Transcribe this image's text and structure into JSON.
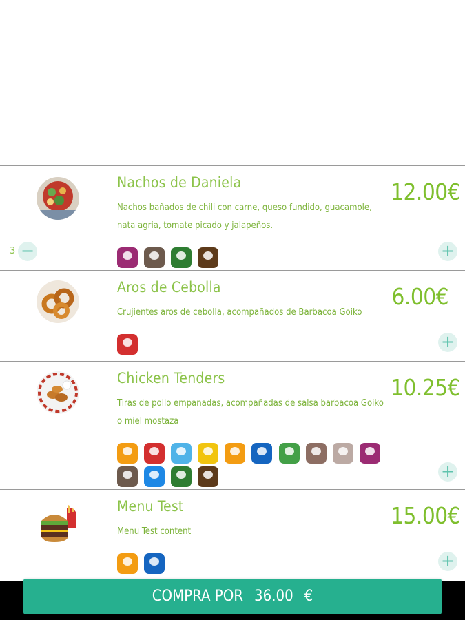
{
  "items": [
    {
      "title": "Nachos de Daniela",
      "description": "Nachos bañados de chili con carne, queso fundido, guacamole, nata agria, tomate picado y jalapeños.",
      "price": "12.00€",
      "quantity": "3",
      "allergen_icons": [
        "mollusk-icon",
        "milk-icon",
        "soy-icon",
        "peanut-icon"
      ],
      "allergen_colors": [
        "#9b2b73",
        "#6d5a4d",
        "#2e7d32",
        "#5d3a1a"
      ]
    },
    {
      "title": "Aros de Cebolla",
      "description": "Crujientes aros de cebolla, acompañados de Barbacoa Goiko",
      "price": "6.00€",
      "allergen_icons": [
        "crustacean-icon"
      ],
      "allergen_colors": [
        "#d32f2f"
      ]
    },
    {
      "title": "Chicken Tenders",
      "description": "Tiras de pollo empanadas, acompañadas de salsa barbacoa Goiko o miel mostaza",
      "price": "10.25€",
      "allergen_icons": [
        "gluten-icon",
        "crustacean-icon",
        "fish-icon",
        "egg-icon",
        "peanut-icon",
        "mustard-icon",
        "celery-icon",
        "nuts-icon",
        "sesame-icon",
        "mollusk-icon",
        "milk-icon",
        "sulphite-icon",
        "soy-icon",
        "lupin-icon"
      ],
      "allergen_colors": [
        "#f39c12",
        "#d32f2f",
        "#4fb3e8",
        "#f1c40f",
        "#f39c12",
        "#1565c0",
        "#43a047",
        "#8d6e63",
        "#bcaaa4",
        "#9b2b73",
        "#6d5a4d",
        "#1e88e5",
        "#2e7d32",
        "#5d3a1a"
      ]
    },
    {
      "title": "Menu Test",
      "description": "Menu Test content",
      "price": "15.00€",
      "allergen_icons": [
        "gluten-icon",
        "sulphite-icon"
      ],
      "allergen_colors": [
        "#f39c12",
        "#1565c0"
      ]
    }
  ],
  "controls": {
    "plus_symbol": "+",
    "minus_symbol": "−"
  },
  "buy_button": {
    "label": "COMPRA POR",
    "amount": "36.00",
    "currency": "€"
  }
}
